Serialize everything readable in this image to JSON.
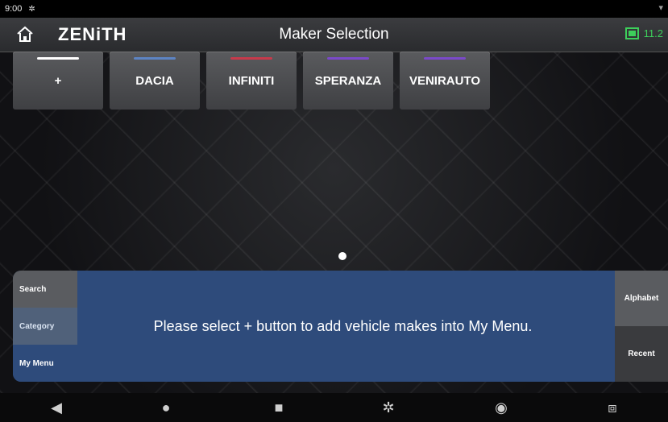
{
  "status_bar": {
    "time": "9:00",
    "left_icon": "gear-icon",
    "right_icon": "signal-icon"
  },
  "header": {
    "home_icon": "home-icon",
    "brand": "ZENiTH",
    "title": "Maker Selection",
    "battery": "11.2"
  },
  "makers": [
    {
      "label": "+",
      "accent": "#ffffff"
    },
    {
      "label": "DACIA",
      "accent": "#5d84c4"
    },
    {
      "label": "INFINITI",
      "accent": "#c83a4b"
    },
    {
      "label": "SPERANZA",
      "accent": "#7b49c9"
    },
    {
      "label": "VENIRAUTO",
      "accent": "#7b49c9"
    }
  ],
  "left_nav": {
    "search": "Search",
    "category": "Category",
    "my_menu": "My Menu"
  },
  "message": "Please select + button to add vehicle makes into My Menu.",
  "right_nav": {
    "alphabet": "Alphabet",
    "recent": "Recent"
  },
  "system_nav": {
    "back_icon": "back-icon",
    "home_icon": "circle-home-icon",
    "recents_icon": "square-recents-icon",
    "settings_icon": "gear-icon",
    "camera_icon": "camera-icon",
    "screenshot_icon": "screenshot-icon"
  }
}
